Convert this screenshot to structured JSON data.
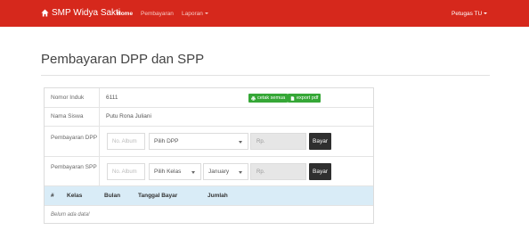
{
  "navbar": {
    "brand": "SMP Widya Sakti",
    "links": [
      "Home",
      "Pembayaran",
      "Laporan"
    ],
    "user": "Petugas TU",
    "color": "#d6281c"
  },
  "page": {
    "title": "Pembayaran DPP dan SPP"
  },
  "form": {
    "nomor_induk": {
      "label": "Nomor Induk",
      "value": "6111"
    },
    "buttons": {
      "cetak": "cetak semua",
      "export": "export pdf"
    },
    "nama_siswa": {
      "label": "Nama Siswa",
      "value": "Putu Rona Juliani"
    },
    "dpp": {
      "label": "Pembayaran DPP",
      "no_album_placeholder": "No. Album",
      "select_value": "Pilih DPP",
      "currency": "Rp.",
      "button": "Bayar"
    },
    "spp": {
      "label": "Pembayaran SPP",
      "no_album_placeholder": "No. Album",
      "kelas_value": "Pilih Kelas",
      "bulan_value": "January",
      "currency": "Rp.",
      "button": "Bayar"
    }
  },
  "table": {
    "columns": [
      "#",
      "Kelas",
      "Bulan",
      "Tanggal Bayar",
      "Jumlah"
    ],
    "empty_message": "Belum ada data!"
  }
}
